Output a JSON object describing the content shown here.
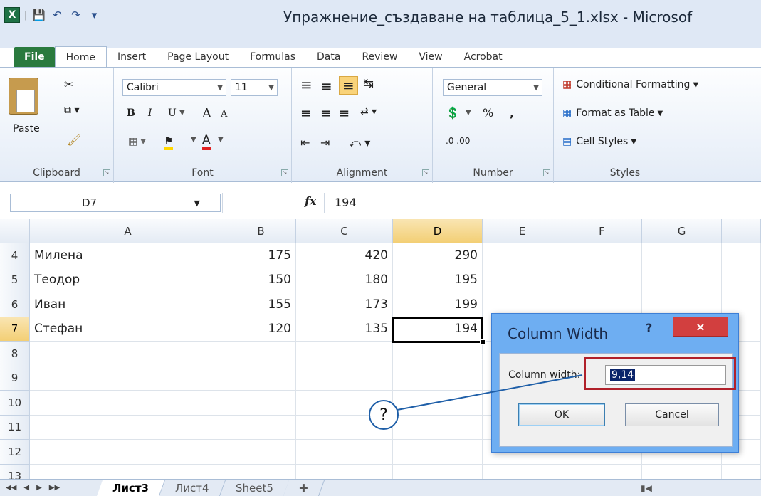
{
  "window": {
    "title": "Упражнение_създаване на таблица_5_1.xlsx - Microsof",
    "app_icon": "X"
  },
  "tabs": [
    "File",
    "Home",
    "Insert",
    "Page Layout",
    "Formulas",
    "Data",
    "Review",
    "View",
    "Acrobat"
  ],
  "ribbon": {
    "clipboard": {
      "paste_label": "Paste",
      "group_label": "Clipboard"
    },
    "font": {
      "name": "Calibri",
      "size": "11",
      "group_label": "Font",
      "bold": "B",
      "italic": "I",
      "underline": "U",
      "grow": "A",
      "shrink": "A",
      "font_color": "A"
    },
    "alignment": {
      "group_label": "Alignment"
    },
    "number": {
      "format": "General",
      "percent": "%",
      "comma": ",",
      "inc_dec": ".0 .00",
      "group_label": "Number"
    },
    "styles": {
      "conditional": "Conditional Formatting",
      "format_table": "Format as Table",
      "cell_styles": "Cell Styles",
      "group_label": "Styles"
    }
  },
  "formula_bar": {
    "name_box": "D7",
    "fx": "fx",
    "value": "194"
  },
  "grid": {
    "columns": [
      "A",
      "B",
      "C",
      "D",
      "E",
      "F",
      "G"
    ],
    "selected_column": "D",
    "rows": [
      {
        "num": "4",
        "cells": [
          "Милена",
          "175",
          "420",
          "290",
          "",
          "",
          ""
        ]
      },
      {
        "num": "5",
        "cells": [
          "Теодор",
          "150",
          "180",
          "195",
          "",
          "",
          ""
        ]
      },
      {
        "num": "6",
        "cells": [
          "Иван",
          "155",
          "173",
          "199",
          "",
          "",
          ""
        ]
      },
      {
        "num": "7",
        "cells": [
          "Стефан",
          "120",
          "135",
          "194",
          "",
          "",
          ""
        ]
      },
      {
        "num": "8",
        "cells": [
          "",
          "",
          "",
          "",
          "",
          "",
          ""
        ]
      },
      {
        "num": "9",
        "cells": [
          "",
          "",
          "",
          "",
          "",
          "",
          ""
        ]
      },
      {
        "num": "10",
        "cells": [
          "",
          "",
          "",
          "",
          "",
          "",
          ""
        ]
      },
      {
        "num": "11",
        "cells": [
          "",
          "",
          "",
          "",
          "",
          "",
          ""
        ]
      },
      {
        "num": "12",
        "cells": [
          "",
          "",
          "",
          "",
          "",
          "",
          ""
        ]
      },
      {
        "num": "13",
        "cells": [
          "",
          "",
          "",
          "",
          "",
          "",
          ""
        ]
      }
    ],
    "selected_row": "7"
  },
  "sheets": [
    "Лист3",
    "Лист4",
    "Sheet5"
  ],
  "active_sheet": "Лист3",
  "dialog": {
    "title": "Column Width",
    "help": "?",
    "close": "×",
    "label": "Column width:",
    "value": "9,14",
    "ok": "OK",
    "cancel": "Cancel"
  },
  "callout": {
    "text": "?"
  },
  "colors": {
    "file_tab": "#2a7a3e",
    "selection": "#f3cf75",
    "dialog_frame": "#6eaef2",
    "highlight": "#b0202a"
  }
}
